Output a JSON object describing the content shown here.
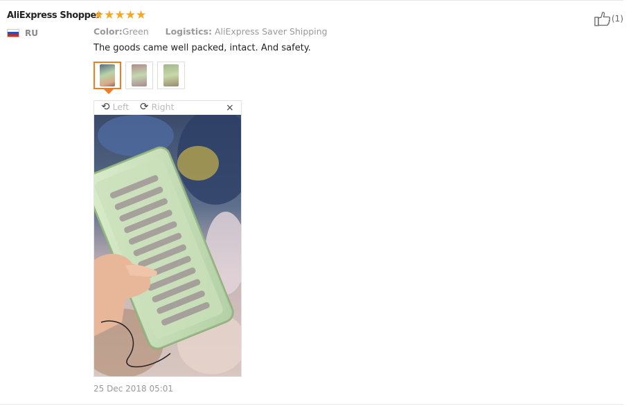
{
  "review": {
    "user_name": "AliExpress Shopper",
    "country_code": "RU",
    "rating_stars": 5,
    "color_label": "Color:",
    "color_value": "Green",
    "logistics_label": "Logistics:",
    "logistics_value": "AliExpress Saver Shipping",
    "text": "The goods came well packed, intact. And safety.",
    "date": "25 Dec 2018 05:01",
    "like_count": "(1)"
  },
  "viewer": {
    "rotate_left_label": "Left",
    "rotate_right_label": "Right",
    "close_icon": "×"
  },
  "colors": {
    "star": "#f5a623",
    "active_thumb_border": "#f27b1e"
  },
  "thumbnails": [
    {
      "name": "thumbnail-1",
      "active": true
    },
    {
      "name": "thumbnail-2",
      "active": false
    },
    {
      "name": "thumbnail-3",
      "active": false
    }
  ]
}
